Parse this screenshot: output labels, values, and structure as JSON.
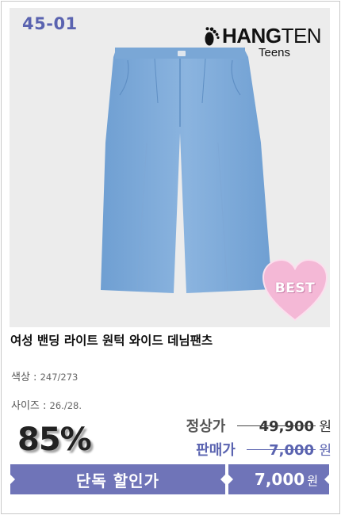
{
  "product": {
    "code": "45-01",
    "brand": {
      "main": "HANG",
      "accent": "TEN",
      "sub": "Teens"
    },
    "badge": "BEST",
    "name": "여성 밴딩 라이트 원턱 와이드 데님팬츠",
    "color_label": "색상 :",
    "color_value": "247/273",
    "size_label": "사이즈 :",
    "size_value": "26./28.",
    "discount": "85%",
    "original_label": "정상가",
    "original_price": "49,900",
    "sale_label": "판매가",
    "sale_price": "7,000",
    "currency": "원",
    "bar_label": "단독 할인가",
    "bar_price": "7,000",
    "bar_currency": "원"
  },
  "colors": {
    "accent": "#6f74b8",
    "denim": "#7fa9d8",
    "badge_pink": "#f4b8d6"
  },
  "icons": {
    "brand_logo": "footprint-icon",
    "badge": "heart-icon"
  }
}
